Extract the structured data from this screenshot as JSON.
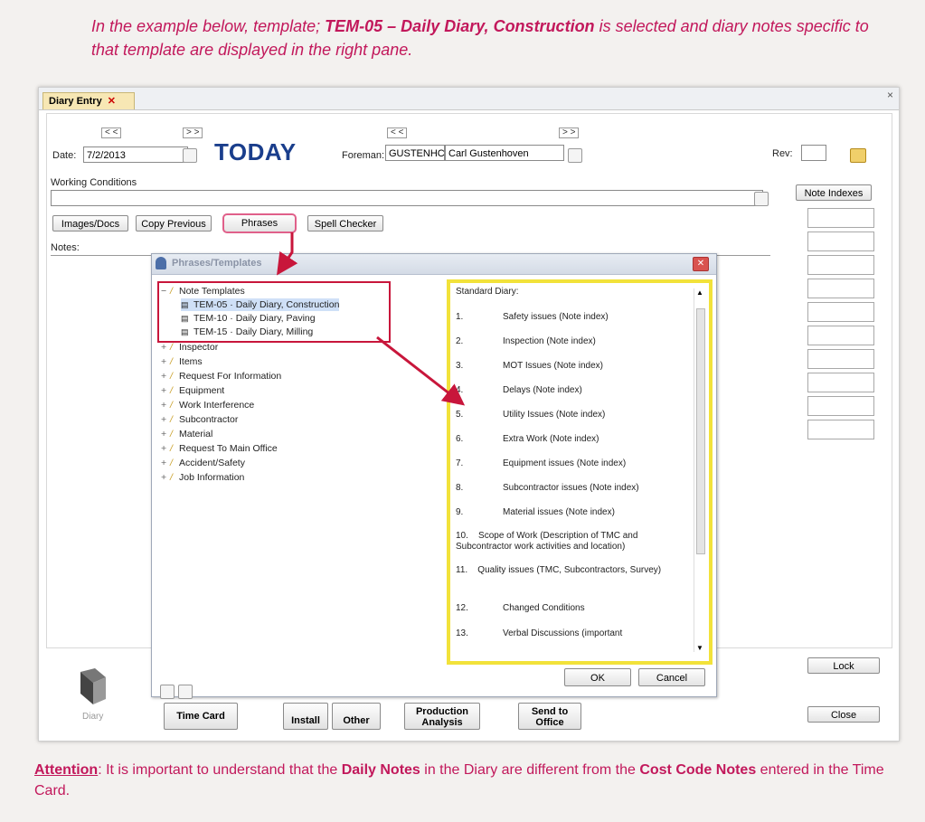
{
  "caption_top": {
    "part1": "In the example below, template; ",
    "bold": "TEM-05 – Daily Diary, Construction",
    "part2": " is selected and diary notes specific to that template are displayed in the right pane."
  },
  "caption_bottom": {
    "att": "Attention",
    "part1": ": It is important to understand that the ",
    "b1": "Daily Notes",
    "part2": " in the Diary are different from the ",
    "b2": "Cost Code Notes",
    "part3": " entered in the Time Card."
  },
  "tab": {
    "label": "Diary Entry",
    "close": "✕"
  },
  "window_close": "×",
  "header": {
    "date_label": "Date:",
    "date_value": "7/2/2013",
    "nav_prev": "< <",
    "nav_next": "> >",
    "today": "TODAY",
    "foreman_label": "Foreman:",
    "foreman_code": "GUSTENHC",
    "foreman_name": "Carl Gustenhoven",
    "rev_label": "Rev:"
  },
  "working_conditions_label": "Working Conditions",
  "note_indexes": "Note Indexes",
  "buttons": {
    "images_docs": "Images/Docs",
    "copy_previous": "Copy Previous",
    "phrases": "Phrases",
    "spell_checker": "Spell Checker",
    "lock": "Lock",
    "close": "Close",
    "ok": "OK",
    "cancel": "Cancel"
  },
  "notes_label": "Notes:",
  "dialog": {
    "title": "Phrases/Templates",
    "tree_root": "Note Templates",
    "templates": [
      {
        "code": "TEM-05",
        "name": "Daily Diary, Construction"
      },
      {
        "code": "TEM-10",
        "name": "Daily Diary, Paving"
      },
      {
        "code": "TEM-15",
        "name": "Daily Diary, Milling"
      }
    ],
    "categories": [
      "Inspector",
      "Items",
      "Request For Information",
      "Equipment",
      "Work Interference",
      "Subcontractor",
      "Material",
      "Request To Main Office",
      "Accident/Safety",
      "Job Information"
    ],
    "standard_header": "Standard Diary:",
    "items": [
      {
        "n": "1.",
        "t": "Safety issues (Note index)"
      },
      {
        "n": "2.",
        "t": "Inspection (Note index)"
      },
      {
        "n": "3.",
        "t": "MOT Issues (Note index)"
      },
      {
        "n": "4.",
        "t": "Delays (Note index)"
      },
      {
        "n": "5.",
        "t": "Utility Issues (Note index)"
      },
      {
        "n": "6.",
        "t": "Extra Work (Note index)"
      },
      {
        "n": "7.",
        "t": "Equipment issues (Note index)"
      },
      {
        "n": "8.",
        "t": "Subcontractor issues (Note index)"
      },
      {
        "n": "9.",
        "t": "Material issues (Note index)"
      },
      {
        "n": "10.",
        "t": "Scope of Work (Description of TMC and Subcontractor work activities and location)"
      },
      {
        "n": "11.",
        "t": "Quality issues (TMC, Subcontractors, Survey)"
      },
      {
        "n": "12.",
        "t": "Changed Conditions"
      },
      {
        "n": "13.",
        "t": "Verbal Discussions (important"
      }
    ]
  },
  "footer": {
    "diary_label": "Diary",
    "time_card": "Time Card",
    "install": "Install",
    "other": "Other",
    "production_analysis_1": "Production",
    "production_analysis_2": "Analysis",
    "send_office_1": "Send to",
    "send_office_2": "Office"
  },
  "colors": {
    "annotation": "#c8163b",
    "caption": "#c2185b",
    "highlight_box": "#f2e23a",
    "today": "#1a3e8c"
  }
}
